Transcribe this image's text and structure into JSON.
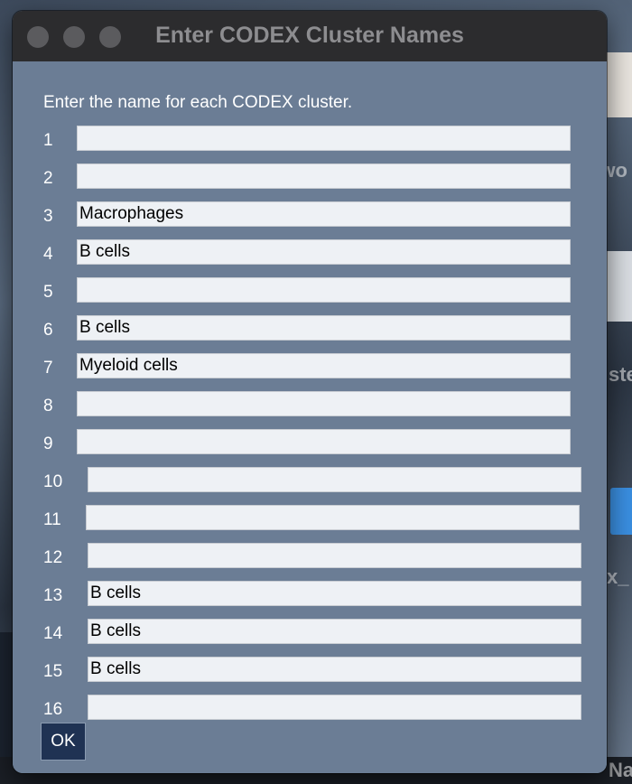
{
  "window": {
    "title": "Enter CODEX Cluster Names"
  },
  "dialog": {
    "instruction": "Enter the name for each CODEX cluster.",
    "ok_label": "OK",
    "clusters": [
      {
        "number": "1",
        "value": ""
      },
      {
        "number": "2",
        "value": ""
      },
      {
        "number": "3",
        "value": "Macrophages"
      },
      {
        "number": "4",
        "value": "B cells"
      },
      {
        "number": "5",
        "value": ""
      },
      {
        "number": "6",
        "value": "B cells"
      },
      {
        "number": "7",
        "value": "Myeloid cells"
      },
      {
        "number": "8",
        "value": ""
      },
      {
        "number": "9",
        "value": ""
      },
      {
        "number": "10",
        "value": ""
      },
      {
        "number": "11",
        "value": ""
      },
      {
        "number": "12",
        "value": ""
      },
      {
        "number": "13",
        "value": "B cells"
      },
      {
        "number": "14",
        "value": "B cells"
      },
      {
        "number": "15",
        "value": "B cells"
      },
      {
        "number": "16",
        "value": ""
      }
    ]
  },
  "background": {
    "text_1": "CODEX wo",
    "text_2": "ste",
    "text_3": "x_",
    "text_4": "Na"
  },
  "colors": {
    "dialog_bg": "#6b7d95",
    "titlebar_bg": "#2c2c2e",
    "ok_button_bg": "#1f3253"
  }
}
